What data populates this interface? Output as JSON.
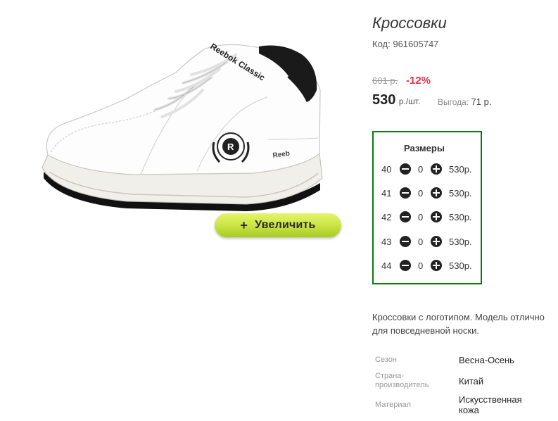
{
  "product": {
    "title": "Кроссовки",
    "code_label": "Код:",
    "code_value": "961605747",
    "zoom_button_label": "Увеличить",
    "zoom_button_icon": "plus-icon",
    "image_logo_text": "Reebok Classic",
    "image_tag_text": "Reeb"
  },
  "pricing": {
    "old_price": "601 р.",
    "discount": "-12%",
    "price": "530",
    "price_unit": "р./шт.",
    "benefit_label": "Выгода:",
    "benefit_value": "71 р."
  },
  "sizes": {
    "title": "Размеры",
    "rows": [
      {
        "size": "40",
        "qty": "0",
        "price": "530р."
      },
      {
        "size": "41",
        "qty": "0",
        "price": "530р."
      },
      {
        "size": "42",
        "qty": "0",
        "price": "530р."
      },
      {
        "size": "43",
        "qty": "0",
        "price": "530р."
      },
      {
        "size": "44",
        "qty": "0",
        "price": "530р."
      }
    ]
  },
  "description": {
    "line1": "Кроссовки с логотипом. Модель отлично",
    "line2": "для повседневной носки."
  },
  "properties": [
    {
      "label": "Сезон",
      "value": "Весна-Осень"
    },
    {
      "label": "Страна-\nпроизводитель",
      "value": "Китай"
    },
    {
      "label": "Материал",
      "value": "Искусственная\nкожа"
    }
  ],
  "colors": {
    "accent_discount": "#e8314a",
    "sizes_border": "#0a7d0a",
    "zoom_button": "#cde64a"
  }
}
